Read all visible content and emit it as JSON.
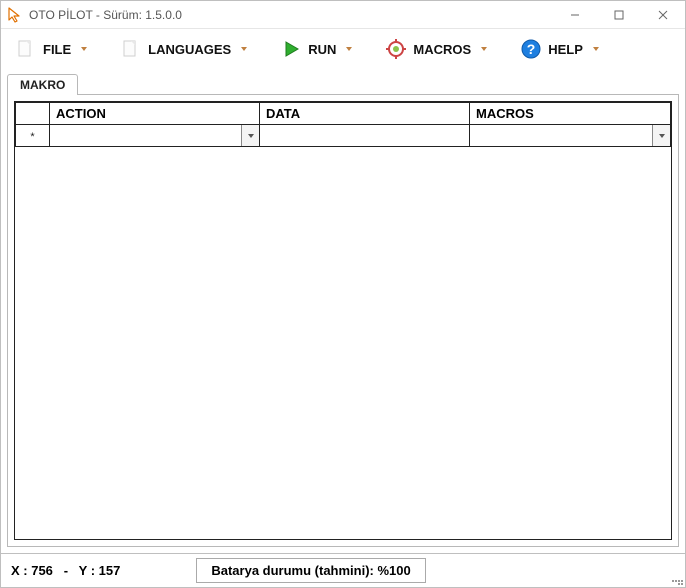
{
  "window": {
    "title": "OTO PİLOT - Sürüm: 1.5.0.0"
  },
  "toolbar": {
    "file": "FILE",
    "languages": "LANGUAGES",
    "run": "RUN",
    "macros": "MACROS",
    "help": "HELP"
  },
  "tabs": {
    "makro": "MAKRO"
  },
  "grid": {
    "columns": {
      "action": "ACTION",
      "data": "DATA",
      "macros": "MACROS"
    },
    "rows": []
  },
  "status": {
    "coords": "X : 756   -   Y : 157",
    "battery": "Batarya durumu (tahmini): %100"
  }
}
